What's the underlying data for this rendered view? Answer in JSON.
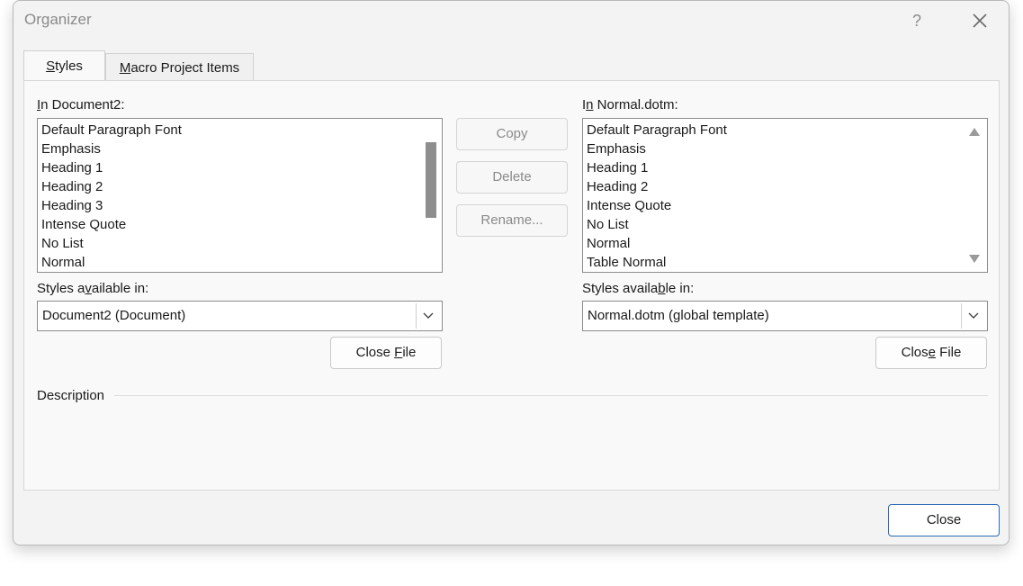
{
  "window": {
    "title": "Organizer",
    "help": "?"
  },
  "tabs": [
    {
      "label_prefix": "",
      "label_ul": "S",
      "label_rest": "tyles"
    },
    {
      "label_prefix": "",
      "label_ul": "M",
      "label_rest": "acro Project Items"
    }
  ],
  "left": {
    "label_ul": "I",
    "label_rest": "n Document2:",
    "items": [
      "Default Paragraph Font",
      "Emphasis",
      "Heading 1",
      "Heading 2",
      "Heading 3",
      "Intense Quote",
      "No List",
      "Normal"
    ],
    "available_pre": "Styles a",
    "available_ul": "v",
    "available_post": "ailable in:",
    "combo_value": "Document2 (Document)",
    "close_pre": "Close ",
    "close_ul": "F",
    "close_post": "ile"
  },
  "right": {
    "label_pre": "I",
    "label_ul": "n",
    "label_rest": " Normal.dotm:",
    "items": [
      "Default Paragraph Font",
      "Emphasis",
      "Heading 1",
      "Heading 2",
      "Intense Quote",
      "No List",
      "Normal",
      "Table Normal"
    ],
    "available_pre": "Styles availa",
    "available_ul": "b",
    "available_post": "le in:",
    "combo_value": "Normal.dotm (global template)",
    "close_pre": "Clos",
    "close_ul": "e",
    "close_post": " File"
  },
  "middle": {
    "copy": "Copy",
    "delete": "Delete",
    "rename": "Rename..."
  },
  "description_label": "Description",
  "footer": {
    "close": "Close"
  }
}
